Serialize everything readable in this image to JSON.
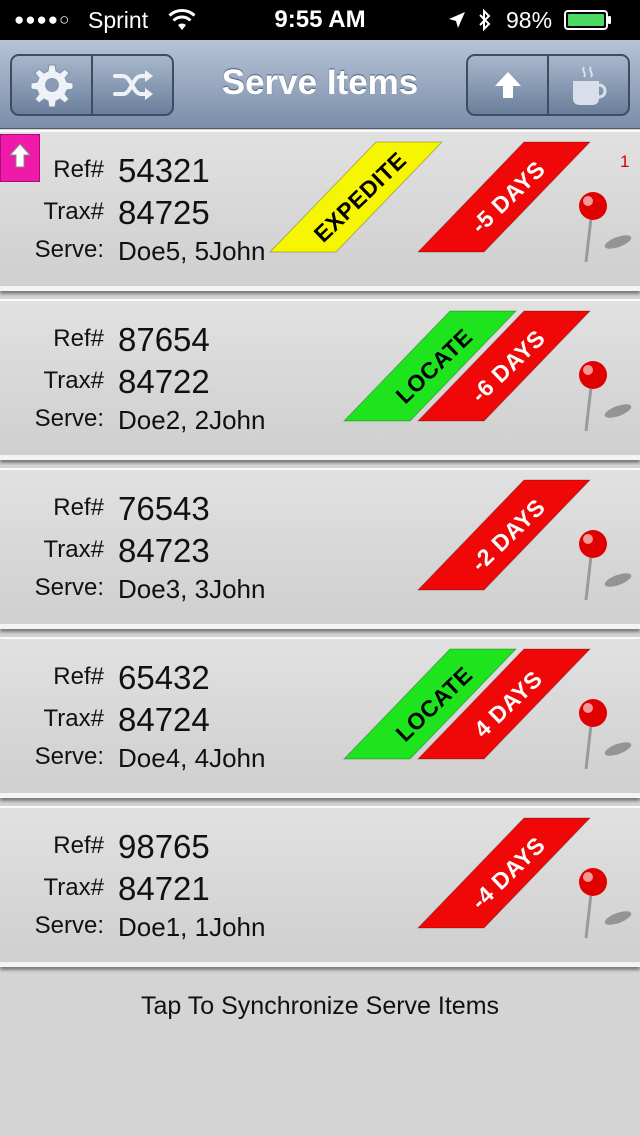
{
  "status_bar": {
    "signal": "●●●●○",
    "carrier": "Sprint",
    "time": "9:55 AM",
    "battery": "98%"
  },
  "nav": {
    "title": "Serve Items",
    "left_buttons": [
      "gear-icon",
      "shuffle-icon"
    ],
    "right_buttons": [
      "up-arrow-icon",
      "coffee-cup-icon"
    ]
  },
  "labels": {
    "ref": "Ref#",
    "trax": "Trax#",
    "serve": "Serve:"
  },
  "items": [
    {
      "ref": "54321",
      "trax": "84725",
      "serve": "Doe5, 5John",
      "status": "EXPEDITE",
      "status_color": "#f6f600",
      "days": "-5 DAYS",
      "count": "1"
    },
    {
      "ref": "87654",
      "trax": "84722",
      "serve": "Doe2, 2John",
      "status": "LOCATE",
      "status_color": "#1ee41e",
      "days": "-6 DAYS",
      "count": ""
    },
    {
      "ref": "76543",
      "trax": "84723",
      "serve": "Doe3, 3John",
      "status": "",
      "status_color": "",
      "days": "-2 DAYS",
      "count": ""
    },
    {
      "ref": "65432",
      "trax": "84724",
      "serve": "Doe4, 4John",
      "status": "LOCATE",
      "status_color": "#1ee41e",
      "days": "4 DAYS",
      "count": ""
    },
    {
      "ref": "98765",
      "trax": "84721",
      "serve": "Doe1, 1John",
      "status": "",
      "status_color": "",
      "days": "-4 DAYS",
      "count": ""
    }
  ],
  "colors": {
    "days_red": "#f00808",
    "nav_top": "#b6c3d7",
    "nav_bottom": "#7a8ea9",
    "move_top_pink": "#f019a9",
    "pin_red": "#e00000"
  },
  "footer": {
    "sync": "Tap To Synchronize Serve Items"
  }
}
